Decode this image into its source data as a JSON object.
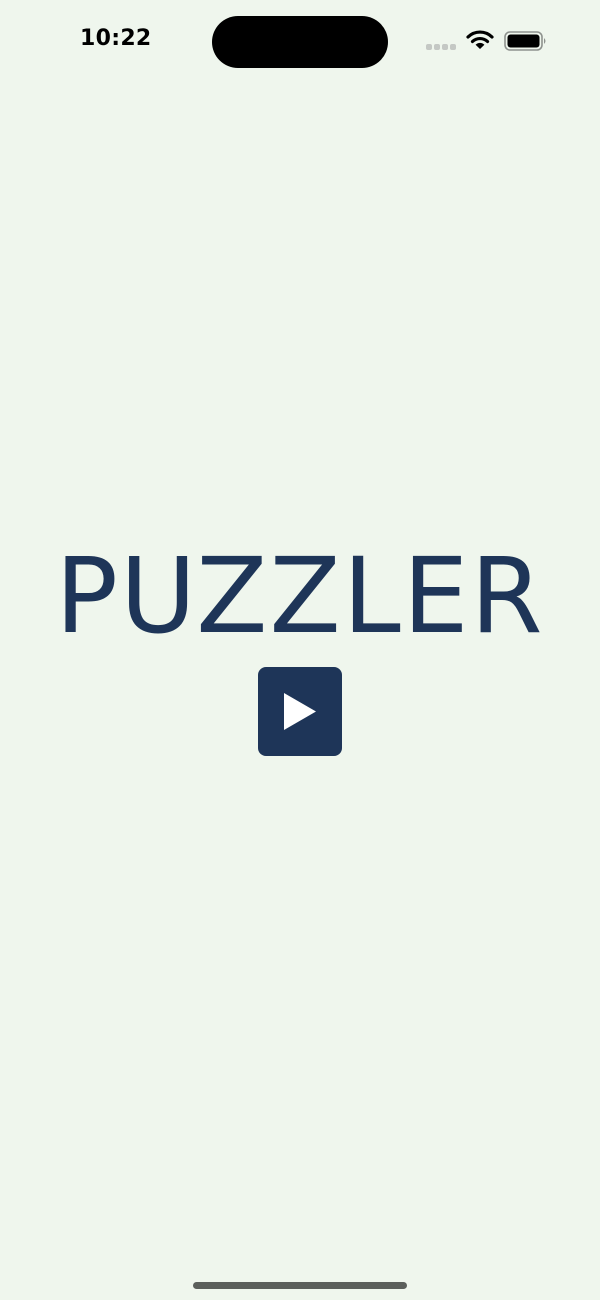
{
  "status_bar": {
    "time": "10:22",
    "signal_icon": "cellular-signal-icon",
    "wifi_icon": "wifi-icon",
    "battery_icon": "battery-icon"
  },
  "main": {
    "title": "PUZZLER",
    "play_button_icon": "play-icon"
  },
  "colors": {
    "background": "#eff6ed",
    "accent": "#1e3558",
    "play_glyph": "#ffffff"
  }
}
